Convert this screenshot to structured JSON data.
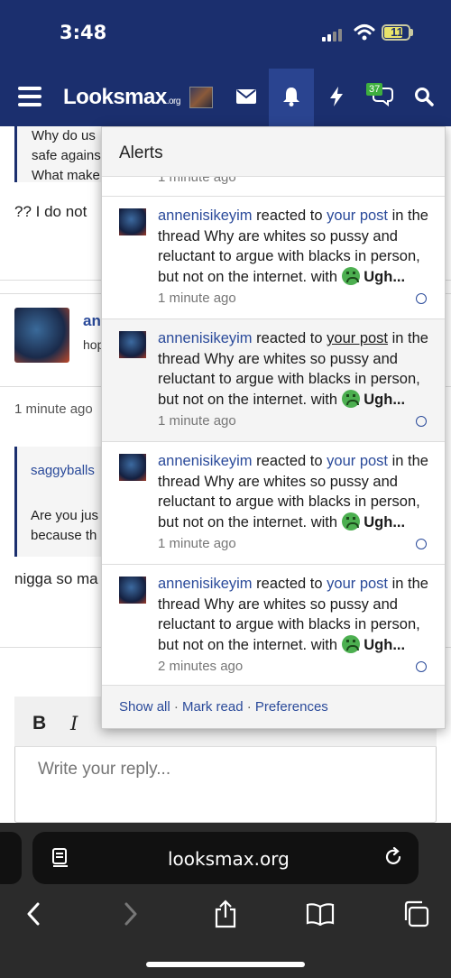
{
  "status_bar": {
    "time": "3:48",
    "battery": "11"
  },
  "nav": {
    "logo_main": "Looksmax",
    "logo_suffix": ".org",
    "chat_badge": "37"
  },
  "background": {
    "quote1_lines": [
      "Why do us",
      "safe agains",
      "What make"
    ],
    "line1": "?? I do not",
    "author_partial": "an",
    "sub_partial": "hop",
    "post_time": "1 minute ago",
    "quote2_name": "saggyballs",
    "quote2_lines": [
      "Are you jus",
      "because th"
    ],
    "line2": "nigga so ma"
  },
  "editor": {
    "bold": "B",
    "italic": "I",
    "placeholder": "Write your reply..."
  },
  "alerts": {
    "title": "Alerts",
    "partial_time": "1 minute ago",
    "items": [
      {
        "user": "annenisikeyim",
        "action": "reacted to",
        "target": "your post",
        "middle": "in the thread Why are whites so pussy and reluctant to argue with blacks in person, but not on the internet. with",
        "reaction": "Ugh...",
        "time": "1 minute ago"
      },
      {
        "user": "annenisikeyim",
        "action": "reacted to",
        "target": "your post",
        "middle": "in the thread Why are whites so pussy and reluctant to argue with blacks in person, but not on the internet. with",
        "reaction": "Ugh...",
        "time": "1 minute ago"
      },
      {
        "user": "annenisikeyim",
        "action": "reacted to",
        "target": "your post",
        "middle": "in the thread Why are whites so pussy and reluctant to argue with blacks in person, but not on the internet. with",
        "reaction": "Ugh...",
        "time": "1 minute ago"
      },
      {
        "user": "annenisikeyim",
        "action": "reacted to",
        "target": "your post",
        "middle": "in the thread Why are whites so pussy and reluctant to argue with blacks in person, but not on the internet. with",
        "reaction": "Ugh...",
        "time": "2 minutes ago"
      }
    ],
    "footer": {
      "show_all": "Show all",
      "mark_read": "Mark read",
      "preferences": "Preferences",
      "separator": "·"
    }
  },
  "safari": {
    "url": "looksmax.org"
  },
  "colors": {
    "nav_bg": "#1b2f6e",
    "link": "#2a4a9a",
    "reaction_green": "#4caf50"
  }
}
